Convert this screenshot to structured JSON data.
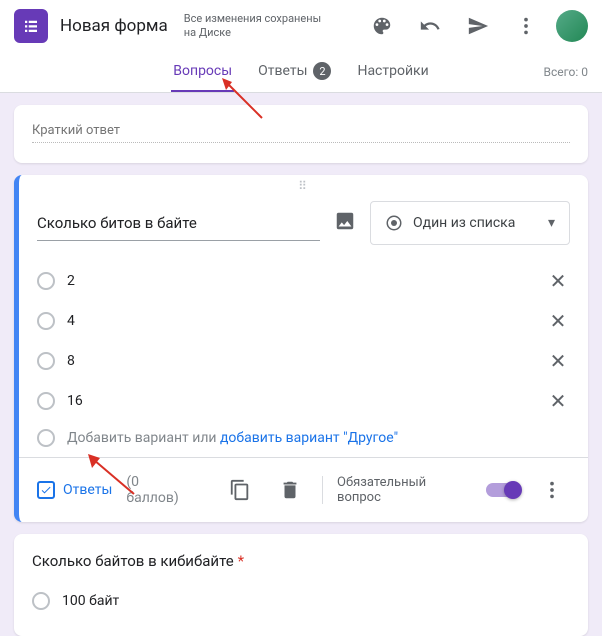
{
  "header": {
    "title": "Новая форма",
    "save_line1": "Все изменения сохранены",
    "save_line2": "на Диске"
  },
  "tabs": {
    "questions": "Вопросы",
    "answers": "Ответы",
    "answers_count": "2",
    "settings": "Настройки",
    "total_label": "Всего: 0"
  },
  "desc": {
    "placeholder": "Краткий ответ"
  },
  "question": {
    "text": "Сколько битов в байте",
    "type_label": "Один из списка",
    "options": [
      "2",
      "4",
      "8",
      "16"
    ],
    "add_option": "Добавить вариант",
    "or": "или",
    "add_other": "добавить вариант \"Другое\"",
    "answers_btn": "Ответы",
    "points": "(0 баллов)",
    "required": "Обязательный вопрос"
  },
  "q2": {
    "title": "Сколько байтов в кибибайте",
    "opt1": "100 байт"
  }
}
